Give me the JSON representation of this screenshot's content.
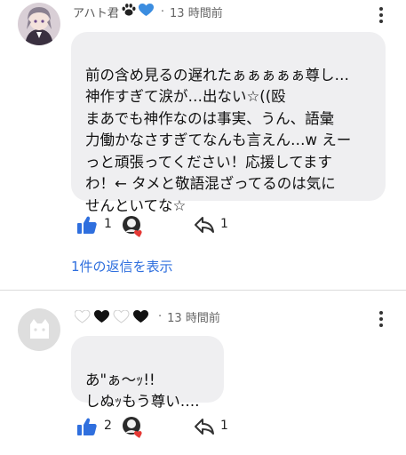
{
  "comment1": {
    "username": "アハト君",
    "time": "13 時間前",
    "text": "前の含め見るの遅れたぁぁぁぁぁ尊し…\n神作すぎて涙が…出ない☆((殴\nまあでも神作なのは事実、うん、語彙\n力働かなさすぎてなんも言えん…w えー\nっと頑張ってください！応援してます\nわ！← タメと敬語混ざってるのは気に\nせんといてな☆",
    "like_count": "1",
    "reply_count": "1",
    "view_replies": "1件の返信を表示"
  },
  "comment2": {
    "username_hearts": "🤍🖤🤍🖤",
    "time": "13 時間前",
    "text": "あ\"ぁ〜ｯ!!\nしぬｯもう尊い….",
    "like_count": "2",
    "reply_count": "1"
  },
  "colors": {
    "like_blue": "#2f6fde",
    "link_blue": "#2f6fde",
    "bubble_bg": "#efeff1",
    "heart_red": "#e53935",
    "divider": "#dcdcdc"
  }
}
